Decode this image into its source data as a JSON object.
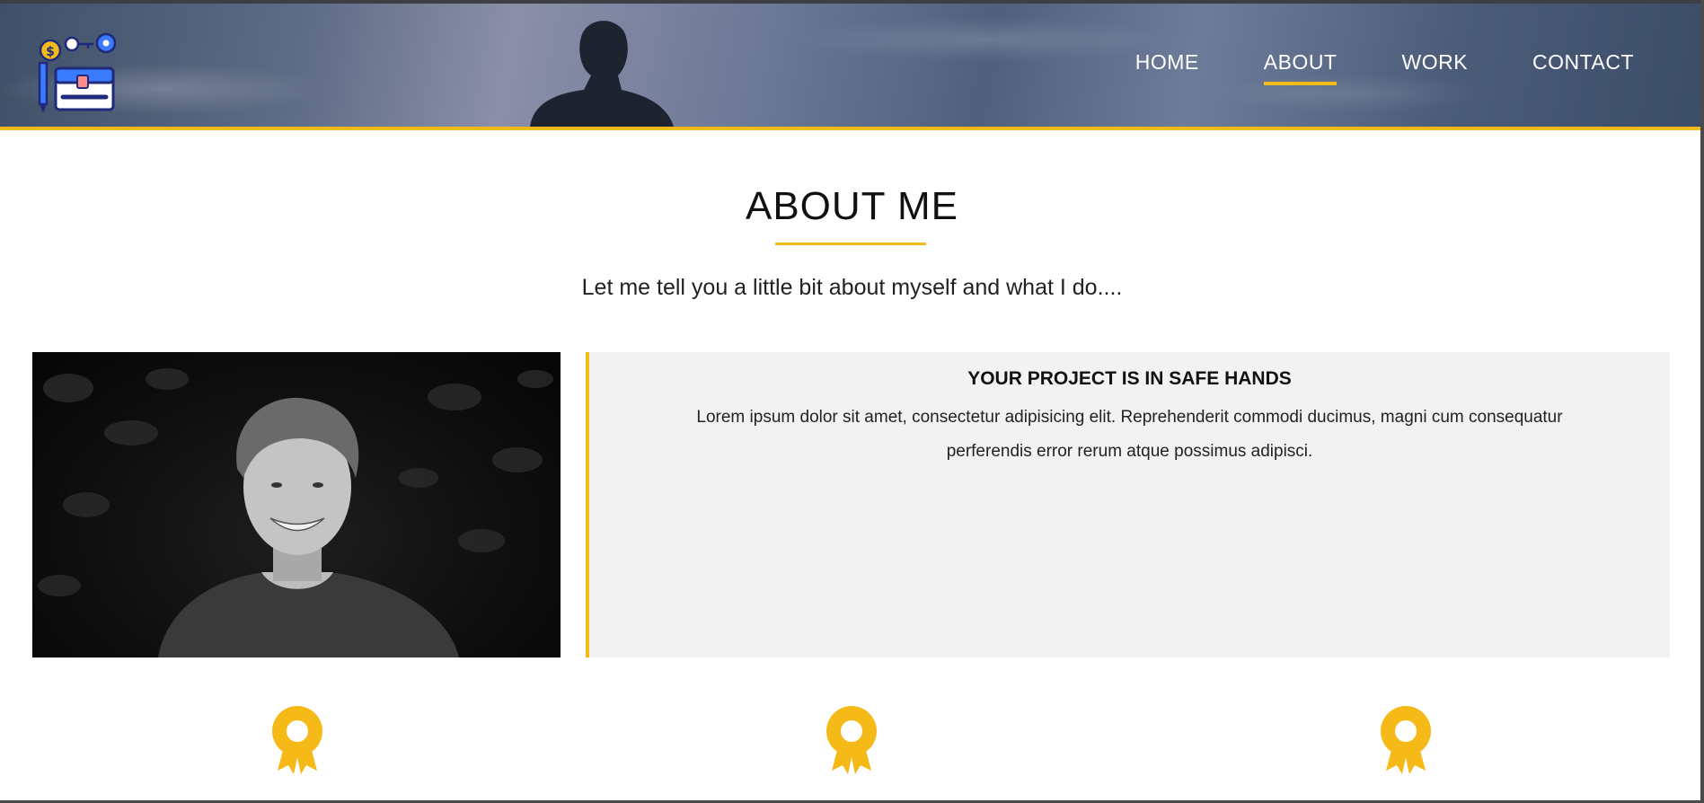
{
  "header": {
    "logo_icon": "toolkit-briefcase-icon",
    "nav": [
      {
        "label": "HOME",
        "active": false
      },
      {
        "label": "ABOUT",
        "active": true
      },
      {
        "label": "WORK",
        "active": false
      },
      {
        "label": "CONTACT",
        "active": false
      }
    ]
  },
  "about": {
    "title": "ABOUT ME",
    "subtitle": "Let me tell you a little bit about myself and what I do....",
    "photo_icon": "profile-photo",
    "card": {
      "title": "YOUR PROJECT IS IN SAFE HANDS",
      "text": "Lorem ipsum dolor sit amet, consectetur adipisicing elit. Reprehenderit commodi ducimus, magni cum consequatur perferendis error rerum atque possimus adipisci."
    },
    "awards": [
      "award-icon",
      "award-icon",
      "award-icon"
    ]
  },
  "colors": {
    "accent": "#f5b918",
    "card_bg": "#f2f2f2",
    "text": "#111111"
  }
}
